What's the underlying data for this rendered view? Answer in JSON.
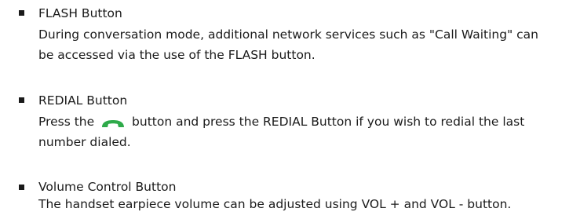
{
  "items": [
    {
      "title": "FLASH Button",
      "lines": [
        "During conversation mode, additional network services such as \"Call Waiting\" can",
        "be accessed via the use of the FLASH button."
      ]
    },
    {
      "title": "REDIAL Button",
      "lines": [
        {
          "before": "Press the",
          "icon": "green-handset-talk-icon",
          "after": "button and press the REDIAL Button if you wish to redial the last"
        },
        "number dialed."
      ]
    },
    {
      "title": "Volume Control Button",
      "lines": [
        "The handset earpiece volume can be adjusted using VOL + and VOL - button."
      ]
    }
  ],
  "colors": {
    "text": "#1a1a1a",
    "bullet": "#1a1a1a",
    "handset_icon": "#2eaa4a"
  }
}
